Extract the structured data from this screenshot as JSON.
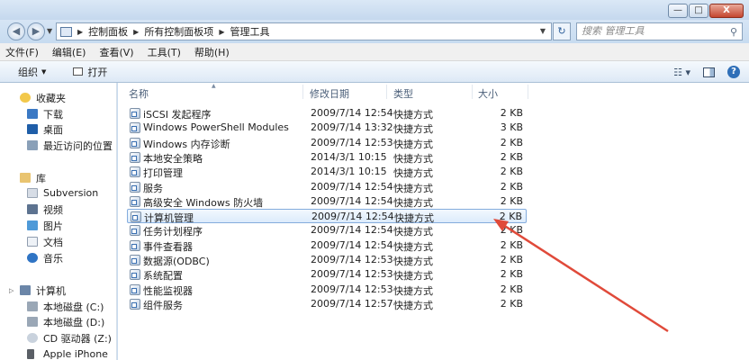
{
  "window": {
    "minimize_glyph": "—",
    "maximize_glyph": "□",
    "close_glyph": "X"
  },
  "address": {
    "crumbs": [
      "控制面板",
      "所有控制面板项",
      "管理工具"
    ],
    "search_placeholder": "搜索 管理工具"
  },
  "menu": [
    "文件(F)",
    "编辑(E)",
    "查看(V)",
    "工具(T)",
    "帮助(H)"
  ],
  "toolbar": {
    "organize_label": "组织",
    "open_label": "打开"
  },
  "nav": {
    "favorites": {
      "label": "收藏夹",
      "items": [
        "下载",
        "桌面",
        "最近访问的位置"
      ]
    },
    "libraries": {
      "label": "库",
      "items": [
        "Subversion",
        "视频",
        "图片",
        "文档",
        "音乐"
      ]
    },
    "computer": {
      "label": "计算机",
      "items": [
        "本地磁盘 (C:)",
        "本地磁盘 (D:)",
        "CD 驱动器 (Z:)",
        "Apple iPhone"
      ]
    }
  },
  "columns": {
    "name": "名称",
    "date": "修改日期",
    "type": "类型",
    "size": "大小"
  },
  "files": [
    {
      "name": "iSCSI 发起程序",
      "date": "2009/7/14 12:54",
      "type": "快捷方式",
      "size": "2 KB"
    },
    {
      "name": "Windows PowerShell Modules",
      "date": "2009/7/14 13:32",
      "type": "快捷方式",
      "size": "3 KB"
    },
    {
      "name": "Windows 内存诊断",
      "date": "2009/7/14 12:53",
      "type": "快捷方式",
      "size": "2 KB"
    },
    {
      "name": "本地安全策略",
      "date": "2014/3/1 10:15",
      "type": "快捷方式",
      "size": "2 KB"
    },
    {
      "name": "打印管理",
      "date": "2014/3/1 10:15",
      "type": "快捷方式",
      "size": "2 KB"
    },
    {
      "name": "服务",
      "date": "2009/7/14 12:54",
      "type": "快捷方式",
      "size": "2 KB"
    },
    {
      "name": "高级安全 Windows 防火墙",
      "date": "2009/7/14 12:54",
      "type": "快捷方式",
      "size": "2 KB"
    },
    {
      "name": "计算机管理",
      "date": "2009/7/14 12:54",
      "type": "快捷方式",
      "size": "2 KB",
      "selected": true
    },
    {
      "name": "任务计划程序",
      "date": "2009/7/14 12:54",
      "type": "快捷方式",
      "size": "2 KB"
    },
    {
      "name": "事件查看器",
      "date": "2009/7/14 12:54",
      "type": "快捷方式",
      "size": "2 KB"
    },
    {
      "name": "数据源(ODBC)",
      "date": "2009/7/14 12:53",
      "type": "快捷方式",
      "size": "2 KB"
    },
    {
      "name": "系统配置",
      "date": "2009/7/14 12:53",
      "type": "快捷方式",
      "size": "2 KB"
    },
    {
      "name": "性能监视器",
      "date": "2009/7/14 12:53",
      "type": "快捷方式",
      "size": "2 KB"
    },
    {
      "name": "组件服务",
      "date": "2009/7/14 12:57",
      "type": "快捷方式",
      "size": "2 KB"
    }
  ],
  "colors": {
    "annotation_arrow": "#e04a3a",
    "selection_border": "#84acdd"
  }
}
